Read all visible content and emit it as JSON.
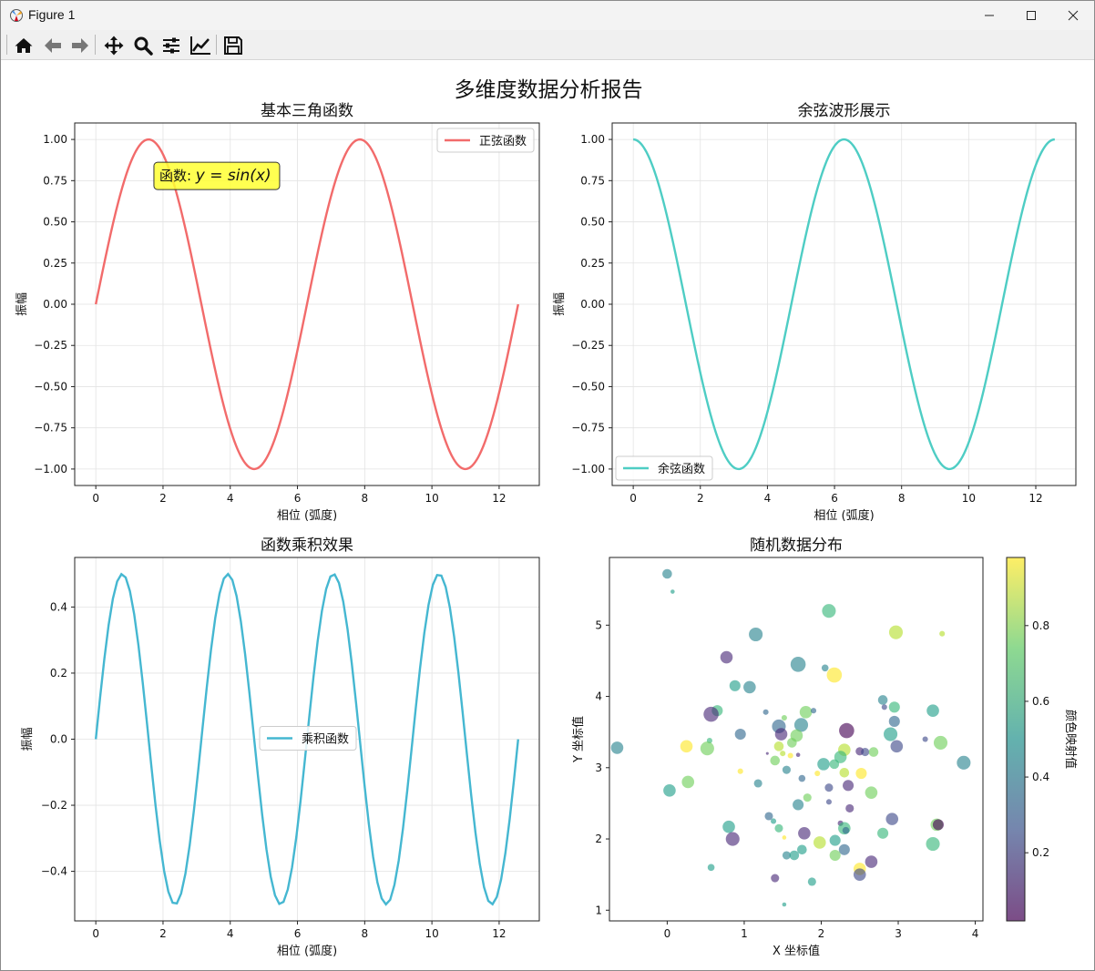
{
  "window": {
    "title": "Figure 1"
  },
  "toolbar": {
    "buttons": [
      "home-icon",
      "back-arrow-icon",
      "forward-arrow-icon",
      "pan-icon",
      "zoom-icon",
      "subplots-icon",
      "edit-axes-icon",
      "save-icon"
    ]
  },
  "colors": {
    "sine": "#f26b6b",
    "cosine": "#4ecdc4",
    "product": "#45b7d1",
    "annotation_bg": "#ffff33",
    "grid": "#e3e3e3"
  },
  "figure": {
    "suptitle": "多维度数据分析报告"
  },
  "chart_data": [
    {
      "type": "line",
      "title": "基本三角函数",
      "xlabel": "相位 (弧度)",
      "ylabel": "振幅",
      "function": "sin",
      "x_range": [
        0,
        12.566
      ],
      "xlim": [
        -0.628,
        13.195
      ],
      "ylim": [
        -1.1,
        1.1
      ],
      "xticks": [
        "0",
        "2",
        "4",
        "6",
        "8",
        "10",
        "12"
      ],
      "yticks": [
        "−1.00",
        "−0.75",
        "−0.50",
        "−0.25",
        "0.00",
        "0.25",
        "0.50",
        "0.75",
        "1.00"
      ],
      "series": [
        {
          "name": "正弦函数",
          "color": "#f26b6b"
        }
      ],
      "legend": "top-right",
      "annotation": {
        "text_prefix": "函数: ",
        "formula": "y = sin(x)",
        "x": 2.0,
        "y": 0.74
      },
      "grid": true
    },
    {
      "type": "line",
      "title": "余弦波形展示",
      "xlabel": "相位 (弧度)",
      "ylabel": "振幅",
      "function": "cos",
      "x_range": [
        0,
        12.566
      ],
      "xlim": [
        -0.628,
        13.195
      ],
      "ylim": [
        -1.1,
        1.1
      ],
      "xticks": [
        "0",
        "2",
        "4",
        "6",
        "8",
        "10",
        "12"
      ],
      "yticks": [
        "−1.00",
        "−0.75",
        "−0.50",
        "−0.25",
        "0.00",
        "0.25",
        "0.50",
        "0.75",
        "1.00"
      ],
      "series": [
        {
          "name": "余弦函数",
          "color": "#4ecdc4"
        }
      ],
      "legend": "bottom-left",
      "grid": true
    },
    {
      "type": "line",
      "title": "函数乘积效果",
      "xlabel": "相位 (弧度)",
      "ylabel": "振幅",
      "function": "sin*cos",
      "x_range": [
        0,
        12.566
      ],
      "samples": 100,
      "xlim": [
        -0.628,
        13.195
      ],
      "ylim": [
        -0.55,
        0.55
      ],
      "xticks": [
        "0",
        "2",
        "4",
        "6",
        "8",
        "10",
        "12"
      ],
      "yticks": [
        "−0.4",
        "−0.2",
        "0.0",
        "0.2",
        "0.4"
      ],
      "series": [
        {
          "name": "乘积函数",
          "color": "#45b7d1"
        }
      ],
      "legend": "center",
      "grid": true
    },
    {
      "type": "scatter",
      "title": "随机数据分布",
      "xlabel": "X 坐标值",
      "ylabel": "Y 坐标值",
      "xlim": [
        -0.75,
        4.1
      ],
      "ylim": [
        0.85,
        5.95
      ],
      "xticks": [
        "0",
        "1",
        "2",
        "3",
        "4"
      ],
      "yticks": [
        "1",
        "2",
        "3",
        "4",
        "5"
      ],
      "colorbar": {
        "label": "颜色映射值",
        "ticks": [
          "0.2",
          "0.4",
          "0.6",
          "0.8"
        ],
        "range": [
          0.02,
          0.98
        ],
        "colormap": "viridis"
      },
      "grid": false,
      "points": [
        {
          "x": 0.0,
          "y": 5.72,
          "c": 0.45,
          "s": 6
        },
        {
          "x": 0.07,
          "y": 5.47,
          "c": 0.55,
          "s": 2
        },
        {
          "x": 2.1,
          "y": 5.2,
          "c": 0.6,
          "s": 9
        },
        {
          "x": 1.15,
          "y": 4.87,
          "c": 0.45,
          "s": 9
        },
        {
          "x": 2.97,
          "y": 4.9,
          "c": 0.82,
          "s": 9
        },
        {
          "x": 3.57,
          "y": 4.88,
          "c": 0.85,
          "s": 3
        },
        {
          "x": 0.77,
          "y": 4.55,
          "c": 0.1,
          "s": 8
        },
        {
          "x": 1.7,
          "y": 4.45,
          "c": 0.48,
          "s": 10
        },
        {
          "x": 2.05,
          "y": 4.4,
          "c": 0.42,
          "s": 4
        },
        {
          "x": 2.17,
          "y": 4.3,
          "c": 0.96,
          "s": 10
        },
        {
          "x": 0.88,
          "y": 4.15,
          "c": 0.55,
          "s": 7
        },
        {
          "x": 1.07,
          "y": 4.13,
          "c": 0.48,
          "s": 8
        },
        {
          "x": 2.8,
          "y": 3.95,
          "c": 0.42,
          "s": 6
        },
        {
          "x": 2.82,
          "y": 3.85,
          "c": 0.2,
          "s": 3
        },
        {
          "x": 2.95,
          "y": 3.85,
          "c": 0.65,
          "s": 7
        },
        {
          "x": 3.45,
          "y": 3.8,
          "c": 0.5,
          "s": 8
        },
        {
          "x": 0.65,
          "y": 3.8,
          "c": 0.6,
          "s": 7
        },
        {
          "x": 0.57,
          "y": 3.75,
          "c": 0.1,
          "s": 10
        },
        {
          "x": 1.28,
          "y": 3.78,
          "c": 0.3,
          "s": 3
        },
        {
          "x": 1.8,
          "y": 3.78,
          "c": 0.75,
          "s": 8
        },
        {
          "x": 1.9,
          "y": 3.8,
          "c": 0.35,
          "s": 3
        },
        {
          "x": 1.52,
          "y": 3.7,
          "c": 0.7,
          "s": 3
        },
        {
          "x": 1.45,
          "y": 3.58,
          "c": 0.3,
          "s": 9
        },
        {
          "x": 1.74,
          "y": 3.6,
          "c": 0.43,
          "s": 9
        },
        {
          "x": 2.95,
          "y": 3.65,
          "c": 0.3,
          "s": 7
        },
        {
          "x": 2.33,
          "y": 3.52,
          "c": 0.08,
          "s": 10
        },
        {
          "x": 0.95,
          "y": 3.47,
          "c": 0.3,
          "s": 7
        },
        {
          "x": 1.48,
          "y": 3.47,
          "c": 0.1,
          "s": 8
        },
        {
          "x": 1.68,
          "y": 3.45,
          "c": 0.7,
          "s": 8
        },
        {
          "x": 2.9,
          "y": 3.47,
          "c": 0.55,
          "s": 9
        },
        {
          "x": 3.35,
          "y": 3.4,
          "c": 0.2,
          "s": 3
        },
        {
          "x": 3.55,
          "y": 3.35,
          "c": 0.7,
          "s": 9
        },
        {
          "x": 0.55,
          "y": 3.38,
          "c": 0.6,
          "s": 3
        },
        {
          "x": 0.25,
          "y": 3.3,
          "c": 0.95,
          "s": 8
        },
        {
          "x": 0.52,
          "y": 3.27,
          "c": 0.75,
          "s": 9
        },
        {
          "x": 1.62,
          "y": 3.35,
          "c": 0.7,
          "s": 6
        },
        {
          "x": 1.45,
          "y": 3.3,
          "c": 0.8,
          "s": 6
        },
        {
          "x": 2.3,
          "y": 3.25,
          "c": 0.8,
          "s": 8
        },
        {
          "x": 2.5,
          "y": 3.23,
          "c": 0.15,
          "s": 5
        },
        {
          "x": 2.57,
          "y": 3.22,
          "c": 0.2,
          "s": 5
        },
        {
          "x": 2.98,
          "y": 3.3,
          "c": 0.25,
          "s": 8
        },
        {
          "x": -0.65,
          "y": 3.28,
          "c": 0.45,
          "s": 8
        },
        {
          "x": 1.5,
          "y": 3.2,
          "c": 0.85,
          "s": 3
        },
        {
          "x": 1.6,
          "y": 3.17,
          "c": 0.9,
          "s": 3
        },
        {
          "x": 1.3,
          "y": 3.2,
          "c": 0.1,
          "s": 1
        },
        {
          "x": 1.7,
          "y": 3.18,
          "c": 0.1,
          "s": 2
        },
        {
          "x": 2.03,
          "y": 3.05,
          "c": 0.5,
          "s": 8
        },
        {
          "x": 2.17,
          "y": 3.05,
          "c": 0.6,
          "s": 6
        },
        {
          "x": 2.25,
          "y": 3.15,
          "c": 0.6,
          "s": 8
        },
        {
          "x": 2.68,
          "y": 3.22,
          "c": 0.7,
          "s": 6
        },
        {
          "x": 3.85,
          "y": 3.07,
          "c": 0.45,
          "s": 9
        },
        {
          "x": 1.4,
          "y": 3.1,
          "c": 0.75,
          "s": 6
        },
        {
          "x": 1.55,
          "y": 2.97,
          "c": 0.45,
          "s": 5
        },
        {
          "x": 2.3,
          "y": 2.93,
          "c": 0.85,
          "s": 6
        },
        {
          "x": 2.52,
          "y": 2.92,
          "c": 0.9,
          "s": 7
        },
        {
          "x": 0.95,
          "y": 2.95,
          "c": 0.95,
          "s": 3
        },
        {
          "x": 1.95,
          "y": 2.92,
          "c": 0.9,
          "s": 3
        },
        {
          "x": 1.18,
          "y": 2.78,
          "c": 0.4,
          "s": 5
        },
        {
          "x": 1.75,
          "y": 2.85,
          "c": 0.35,
          "s": 4
        },
        {
          "x": 0.27,
          "y": 2.8,
          "c": 0.75,
          "s": 8
        },
        {
          "x": 2.1,
          "y": 2.72,
          "c": 0.2,
          "s": 5
        },
        {
          "x": 2.35,
          "y": 2.75,
          "c": 0.1,
          "s": 7
        },
        {
          "x": 0.03,
          "y": 2.68,
          "c": 0.55,
          "s": 8
        },
        {
          "x": 2.65,
          "y": 2.65,
          "c": 0.7,
          "s": 8
        },
        {
          "x": 1.82,
          "y": 2.58,
          "c": 0.72,
          "s": 5
        },
        {
          "x": 2.1,
          "y": 2.52,
          "c": 0.2,
          "s": 3
        },
        {
          "x": 1.7,
          "y": 2.48,
          "c": 0.4,
          "s": 7
        },
        {
          "x": 2.37,
          "y": 2.43,
          "c": 0.1,
          "s": 5
        },
        {
          "x": 1.32,
          "y": 2.32,
          "c": 0.3,
          "s": 5
        },
        {
          "x": 1.38,
          "y": 2.25,
          "c": 0.5,
          "s": 3
        },
        {
          "x": 2.25,
          "y": 2.22,
          "c": 0.1,
          "s": 3
        },
        {
          "x": 2.92,
          "y": 2.28,
          "c": 0.25,
          "s": 8
        },
        {
          "x": 3.5,
          "y": 2.2,
          "c": 0.7,
          "s": 8
        },
        {
          "x": 3.52,
          "y": 2.2,
          "c": 0.05,
          "s": 7
        },
        {
          "x": 0.8,
          "y": 2.17,
          "c": 0.55,
          "s": 8
        },
        {
          "x": 1.45,
          "y": 2.15,
          "c": 0.6,
          "s": 5
        },
        {
          "x": 2.3,
          "y": 2.15,
          "c": 0.6,
          "s": 8
        },
        {
          "x": 2.32,
          "y": 2.12,
          "c": 0.35,
          "s": 4
        },
        {
          "x": 0.85,
          "y": 2.0,
          "c": 0.1,
          "s": 9
        },
        {
          "x": 1.78,
          "y": 2.08,
          "c": 0.12,
          "s": 8
        },
        {
          "x": 2.8,
          "y": 2.08,
          "c": 0.6,
          "s": 7
        },
        {
          "x": 1.52,
          "y": 2.02,
          "c": 0.9,
          "s": 2
        },
        {
          "x": 1.98,
          "y": 1.95,
          "c": 0.8,
          "s": 8
        },
        {
          "x": 2.18,
          "y": 1.98,
          "c": 0.55,
          "s": 7
        },
        {
          "x": 1.75,
          "y": 1.85,
          "c": 0.5,
          "s": 6
        },
        {
          "x": 2.3,
          "y": 1.85,
          "c": 0.35,
          "s": 7
        },
        {
          "x": 3.45,
          "y": 1.93,
          "c": 0.6,
          "s": 9
        },
        {
          "x": 1.55,
          "y": 1.77,
          "c": 0.4,
          "s": 5
        },
        {
          "x": 1.65,
          "y": 1.77,
          "c": 0.55,
          "s": 6
        },
        {
          "x": 2.18,
          "y": 1.77,
          "c": 0.7,
          "s": 7
        },
        {
          "x": 2.65,
          "y": 1.68,
          "c": 0.15,
          "s": 8
        },
        {
          "x": 0.57,
          "y": 1.6,
          "c": 0.55,
          "s": 4
        },
        {
          "x": 2.5,
          "y": 1.58,
          "c": 0.92,
          "s": 8
        },
        {
          "x": 2.5,
          "y": 1.5,
          "c": 0.2,
          "s": 8
        },
        {
          "x": 1.4,
          "y": 1.45,
          "c": 0.15,
          "s": 5
        },
        {
          "x": 1.88,
          "y": 1.4,
          "c": 0.5,
          "s": 5
        },
        {
          "x": 1.52,
          "y": 1.08,
          "c": 0.55,
          "s": 2
        }
      ]
    }
  ]
}
